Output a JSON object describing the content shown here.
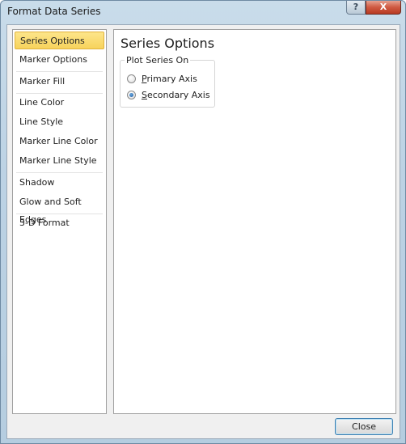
{
  "window": {
    "title": "Format Data Series",
    "help_label": "?",
    "close_label": "X"
  },
  "sidebar": {
    "items": [
      {
        "label": "Series Options",
        "selected": true
      },
      {
        "label": "Marker Options"
      },
      {
        "label": "Marker Fill"
      },
      {
        "label": "Line Color"
      },
      {
        "label": "Line Style"
      },
      {
        "label": "Marker Line Color"
      },
      {
        "label": "Marker Line Style"
      },
      {
        "label": "Shadow"
      },
      {
        "label": "Glow and Soft Edges"
      },
      {
        "label": "3-D Format"
      }
    ]
  },
  "main": {
    "section_title": "Series Options",
    "group_label": "Plot Series On",
    "options": [
      {
        "mnemonic": "P",
        "rest": "rimary Axis",
        "checked": false
      },
      {
        "mnemonic": "S",
        "rest": "econdary Axis",
        "checked": true
      }
    ]
  },
  "footer": {
    "close_button": "Close"
  },
  "colors": {
    "selected_item": "#f7d35c",
    "close_button_red": "#cf5a42"
  }
}
